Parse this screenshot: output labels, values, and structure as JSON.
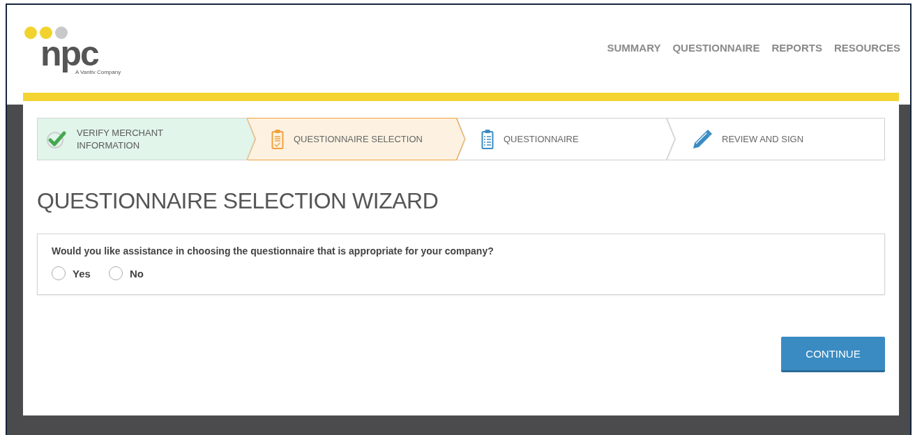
{
  "brand": {
    "name": "npc",
    "tagline": "A Vantiv Company"
  },
  "nav": [
    "SUMMARY",
    "QUESTIONNAIRE",
    "REPORTS",
    "RESOURCES"
  ],
  "steps": [
    {
      "label": "VERIFY MERCHANT INFORMATION",
      "completed": true,
      "selected": false,
      "kind": "check"
    },
    {
      "label": "QUESTIONNAIRE SELECTION",
      "completed": false,
      "selected": true,
      "kind": "clipboard"
    },
    {
      "label": "QUESTIONNAIRE",
      "completed": false,
      "selected": false,
      "kind": "list"
    },
    {
      "label": "REVIEW AND SIGN",
      "completed": false,
      "selected": false,
      "kind": "pencil"
    }
  ],
  "title": "QUESTIONNAIRE SELECTION WIZARD",
  "question": {
    "text": "Would you like assistance in choosing the questionnaire that is appropriate for your company?",
    "options": [
      {
        "label": "Yes",
        "selected": false
      },
      {
        "label": "No",
        "selected": false
      }
    ]
  },
  "continue_button": "CONTINUE"
}
